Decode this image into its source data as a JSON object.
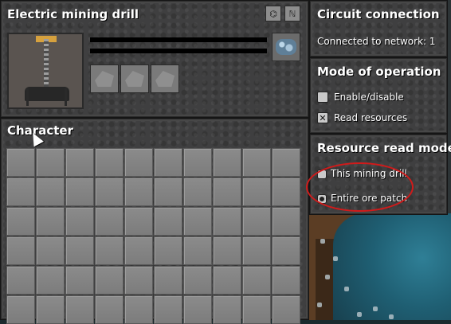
{
  "entity": {
    "title": "Electric mining drill",
    "header_icons": [
      "network-icon",
      "circuit-icon"
    ],
    "output_slot_icon": "iron-ore-icon",
    "module_slot_count": 3
  },
  "character": {
    "title": "Character",
    "inventory_columns": 10,
    "inventory_rows": 6
  },
  "circuit": {
    "title": "Circuit connection",
    "status": "Connected to network: 1"
  },
  "mode": {
    "title": "Mode of operation",
    "options": [
      {
        "label": "Enable/disable",
        "checked": false
      },
      {
        "label": "Read resources",
        "checked": true
      }
    ]
  },
  "read_mode": {
    "title": "Resource read mode",
    "options": [
      {
        "label": "This mining drill",
        "selected": false
      },
      {
        "label": "Entire ore patch",
        "selected": true
      }
    ]
  },
  "colors": {
    "panel": "#3c3c3c",
    "slot": "#858585",
    "highlight": "#d11a1a",
    "water": "#1f5f73"
  }
}
